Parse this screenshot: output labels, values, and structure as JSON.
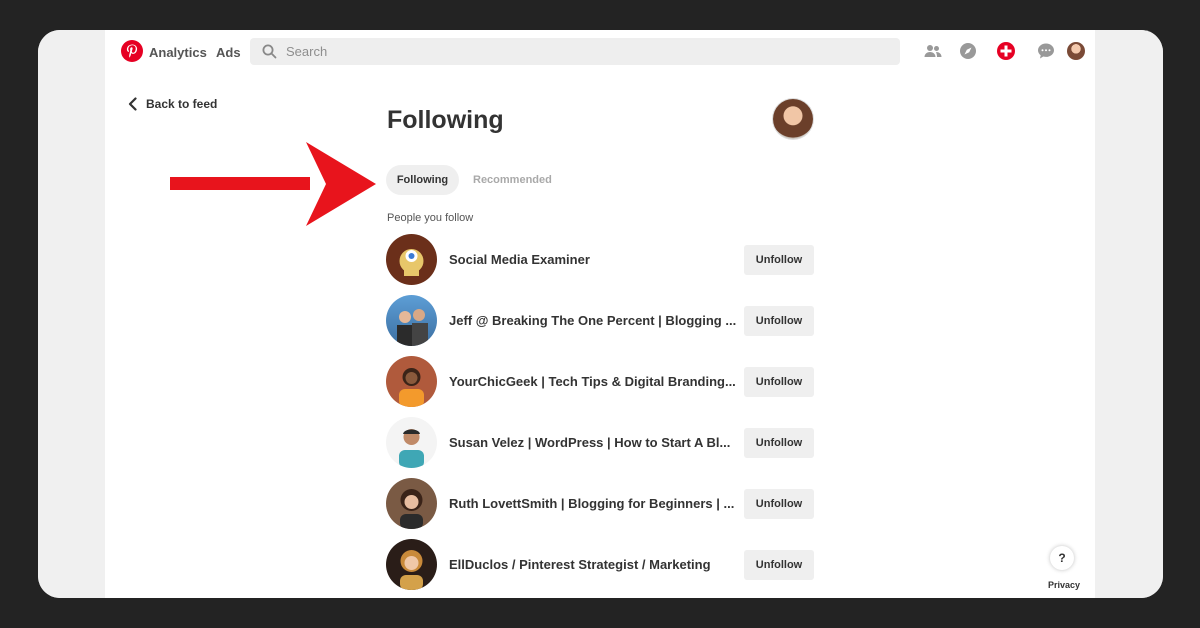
{
  "header": {
    "nav": [
      "Analytics",
      "Ads"
    ],
    "search_placeholder": "Search",
    "accent": "#e60023"
  },
  "back_label": "Back to feed",
  "page_title": "Following",
  "tabs": [
    {
      "label": "Following",
      "active": true
    },
    {
      "label": "Recommended",
      "active": false
    }
  ],
  "section_label": "People you follow",
  "people": [
    {
      "name": "Social Media Examiner",
      "button": "Unfollow"
    },
    {
      "name": "Jeff @ Breaking The One Percent | Blogging ...",
      "button": "Unfollow"
    },
    {
      "name": "YourChicGeek | Tech Tips & Digital Branding...",
      "button": "Unfollow"
    },
    {
      "name": "Susan Velez | WordPress | How to Start A Bl...",
      "button": "Unfollow"
    },
    {
      "name": "Ruth LovettSmith | Blogging for Beginners | ...",
      "button": "Unfollow"
    },
    {
      "name": "EllDuclos / Pinterest Strategist / Marketing",
      "button": "Unfollow"
    }
  ],
  "help_label": "?",
  "privacy_label": "Privacy",
  "annotation_color": "#e8141c"
}
